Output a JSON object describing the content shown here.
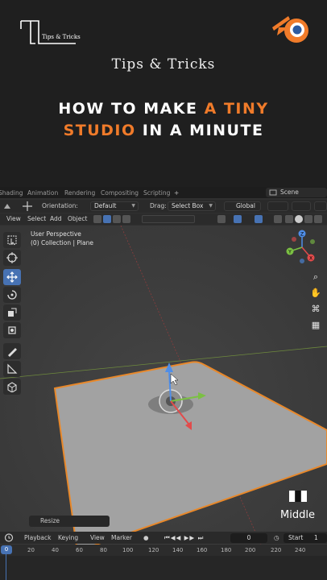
{
  "banner": {
    "brand_text": "Tips & Tricks",
    "subtitle": "Tips & Tricks",
    "headline_line1_a": "HOW TO MAKE ",
    "headline_line1_b": "A TINY",
    "headline_line2_a": "STUDIO",
    "headline_line2_b": " IN A MINUTE",
    "accent_color": "#f07b2a"
  },
  "workspaces": {
    "tabs": [
      "Shading",
      "Animation",
      "Rendering",
      "Compositing",
      "Scripting"
    ],
    "add_label": "+",
    "scene": "Scene"
  },
  "header": {
    "orientation_label": "Orientation:",
    "orientation_value": "Default",
    "drag_label": "Drag:",
    "drag_value": "Select Box",
    "transform_value": "Global"
  },
  "menu": {
    "view": "View",
    "select": "Select",
    "add": "Add",
    "object": "Object"
  },
  "viewport": {
    "perspective": "User Perspective",
    "collection": "(0) Collection | Plane",
    "resize_label": "Resize",
    "mouse_label": "Middle",
    "gizmo_axes": [
      "X",
      "Y",
      "Z"
    ]
  },
  "timeline": {
    "playback": "Playback",
    "keying": "Keying",
    "view": "View",
    "marker": "Marker",
    "current_frame": "0",
    "start_label": "Start",
    "start_value": "1",
    "ruler_ticks": [
      "0",
      "20",
      "40",
      "60",
      "80",
      "100",
      "120",
      "140",
      "160",
      "180",
      "200",
      "220",
      "240"
    ]
  },
  "colors": {
    "active_tool": "#4772b3",
    "selection_outline": "#e8882a",
    "plane": "#a2a2a2"
  }
}
